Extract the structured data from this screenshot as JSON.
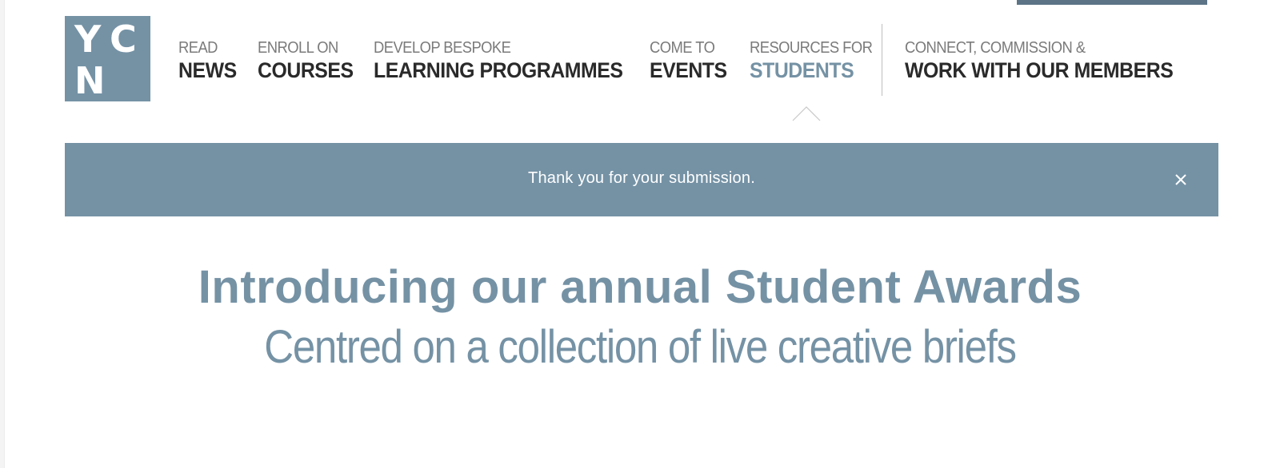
{
  "logo": {
    "letters": [
      "Y",
      "C",
      "N"
    ],
    "color": "#7592a5"
  },
  "nav": {
    "items": [
      {
        "small": "READ",
        "big": "NEWS"
      },
      {
        "small": "ENROLL ON",
        "big": "COURSES"
      },
      {
        "small": "DEVELOP BESPOKE",
        "big": "LEARNING PROGRAMMES"
      },
      {
        "small": "COME TO",
        "big": "EVENTS"
      },
      {
        "small": "RESOURCES FOR",
        "big": "STUDENTS"
      },
      {
        "small": "CONNECT, COMMISSION &",
        "big": "WORK WITH OUR MEMBERS"
      }
    ],
    "active_item": "STUDENTS",
    "pointer_icon": "chevron-up-icon"
  },
  "notice": {
    "message": "Thank you for your submission.",
    "close_icon": "close-icon",
    "background": "#7592a5"
  },
  "hero": {
    "headline": "Introducing our annual Student Awards",
    "subheadline": "Centred on a collection of live creative briefs"
  },
  "colors": {
    "accent": "#7592a5",
    "text_dark": "#2a2a2a",
    "text_muted": "#7b7b7b",
    "top_bar": "#5c7486"
  }
}
